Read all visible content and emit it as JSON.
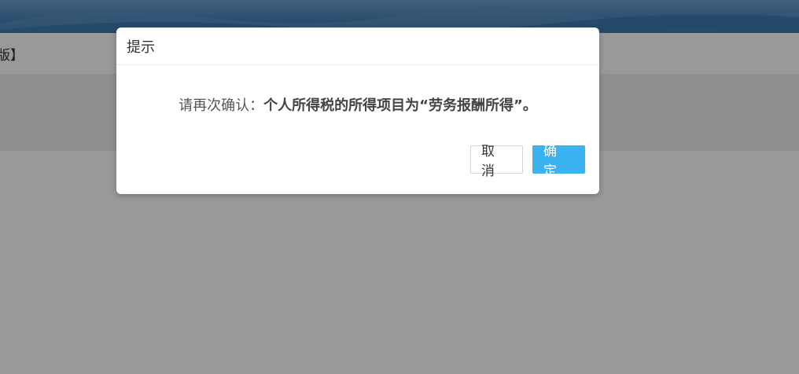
{
  "page": {
    "subnav_label": "版】"
  },
  "dialog": {
    "title": "提示",
    "message_prefix": "请再次确认：",
    "message_emphasis": "个人所得税的所得项目为“劳务报酬所得”。",
    "cancel_label": "取消",
    "ok_label": "确定"
  },
  "colors": {
    "primary": "#3ab3f0",
    "overlay": "rgba(0,0,0,0.40)",
    "banner": "#4d86bb"
  }
}
